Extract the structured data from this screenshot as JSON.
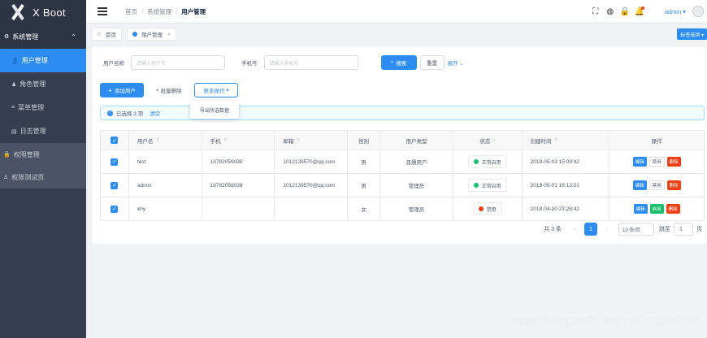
{
  "app": {
    "title": "X Boot"
  },
  "sidebar": {
    "group": {
      "label": "系统管理"
    },
    "items": [
      {
        "label": "用户管理",
        "active": true
      },
      {
        "label": "角色管理"
      },
      {
        "label": "菜单管理"
      },
      {
        "label": "日志管理"
      }
    ],
    "others": [
      {
        "label": "权限管理"
      },
      {
        "label": "权限测试页"
      }
    ]
  },
  "header": {
    "breadcrumb": [
      "首页",
      "系统管理",
      "用户管理"
    ],
    "user": "admin ▾"
  },
  "tags": {
    "items": [
      {
        "label": "首页"
      },
      {
        "label": "用户管理"
      }
    ],
    "menu_label": "标签选项 ▾"
  },
  "search": {
    "username_label": "用户名称",
    "username_placeholder": "请输入用户名",
    "mobile_label": "手机号",
    "mobile_placeholder": "请输入手机号",
    "search_button": "搜索",
    "reset_button": "重置",
    "expand_link": "展开"
  },
  "toolbar": {
    "add_button": "添加用户",
    "batch_delete_button": "批量删除",
    "more_button": "更多操作",
    "dropdown_item": "导出所选数据"
  },
  "alert": {
    "selected_text": "已选择 3 项",
    "clear_link": "清空"
  },
  "table": {
    "headers": [
      "用户名",
      "手机",
      "邮箱",
      "性别",
      "用户类型",
      "状态",
      "创建时间",
      "操作"
    ],
    "rows": [
      {
        "username": "test",
        "mobile": "18782059038",
        "email": "1012139570@qq.com",
        "gender": "男",
        "type": "普通用户",
        "status": "正常启用",
        "created": "2018-05-03 15:09:42",
        "toggle": "禁用"
      },
      {
        "username": "admin",
        "mobile": "18782059038",
        "email": "1012139570@qq.com",
        "gender": "男",
        "type": "管理员",
        "status": "正常启用",
        "created": "2018-05-01 16:13:51",
        "toggle": "禁用"
      },
      {
        "username": "xhy",
        "mobile": "",
        "email": "",
        "gender": "女",
        "type": "管理员",
        "status": "禁用",
        "created": "2018-04-30 23:28:42",
        "toggle": "启用"
      }
    ],
    "actions": {
      "edit": "编辑",
      "delete": "删除"
    }
  },
  "pager": {
    "total_text": "共 3 条",
    "current_page": "1",
    "page_size": "10 条/页",
    "jump_label": "跳至",
    "jump_value": "1",
    "page_suffix": "页"
  },
  "watermark": "https://blog.csdn.net/YOUYOU0710",
  "colors": {
    "primary": "#2d8cf0",
    "success": "#19be6b",
    "error": "#ed4014",
    "sidebar": "#363e4f"
  }
}
